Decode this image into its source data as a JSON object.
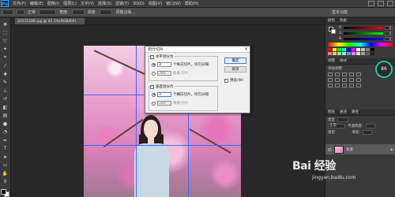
{
  "app": {
    "logo": "Ps"
  },
  "menubar": {
    "items": [
      "文件(F)",
      "编辑(E)",
      "图像(I)",
      "图层(L)",
      "文字(Y)",
      "选择(S)",
      "滤镜(T)",
      "3D(D)",
      "视图(V)",
      "窗口(W)",
      "帮助(H)"
    ]
  },
  "options": {
    "style_label": "正常",
    "width_label": "宽度:",
    "height_label": "高度:",
    "refine_edge": "调整边缘...",
    "workspace": "基本功能"
  },
  "document": {
    "tab_title": "20531188.jpg @ 45.5%(RGB/8#)"
  },
  "dialog": {
    "title": "划分切片",
    "close": "×",
    "horizontal": {
      "check_label": "水平划分为",
      "option1_value": "3",
      "option1_label": "个纵向切片，均匀分隔",
      "option2_value": "384",
      "option2_label": "像素/切片"
    },
    "vertical": {
      "check_label": "垂直划分为",
      "option1_value": "3",
      "option1_label": "个横向切片，均匀分隔",
      "option2_value": "384",
      "option2_label": "像素/切片"
    },
    "ok": "确定",
    "cancel": "取消",
    "preview": "预览(W)"
  },
  "right_panel": {
    "color_tabs": [
      "颜色",
      "色板"
    ],
    "sliders": [
      {
        "label": "R",
        "value": "0",
        "gradient": "linear-gradient(90deg, #000, #f00)"
      },
      {
        "label": "G",
        "value": "0",
        "gradient": "linear-gradient(90deg, #000, #0f0)"
      },
      {
        "label": "B",
        "value": "0",
        "gradient": "linear-gradient(90deg, #000, #00f)"
      }
    ],
    "swatch_colors": [
      "#ff0000",
      "#ffff00",
      "#00ff00",
      "#00ffff",
      "#0000ff",
      "#ff00ff",
      "#ffffff",
      "#c0c0c0",
      "#808080",
      "#000000",
      "#ff8080",
      "#ffc080",
      "#80ff80",
      "#80ffff",
      "#8080ff",
      "#ff80ff",
      "#e0e0e0",
      "#a0a0a0",
      "#606060",
      "#202020"
    ],
    "badge": "86",
    "adjust_tabs": [
      "调整",
      "样式"
    ],
    "adjust_label": "添加调整",
    "layers_tabs": [
      "图层",
      "通道",
      "路径"
    ],
    "layer_kind": "类型",
    "blend_mode": "正常",
    "opacity_label": "不透明度:",
    "lock_label": "锁定:",
    "fill_label": "填充:",
    "layer_name": "背景"
  },
  "watermark": {
    "main": "Bai 经验",
    "url": "jingyan.baidu.com"
  }
}
